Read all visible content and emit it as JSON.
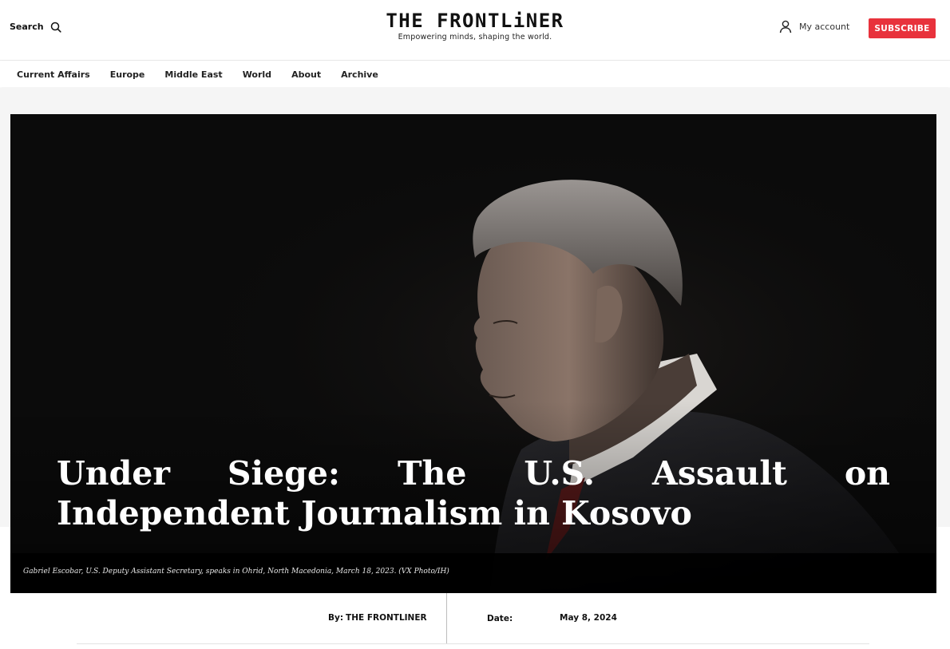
{
  "header": {
    "search_label": "Search",
    "logo_title": "THE FRONTLiNER",
    "logo_tagline": "Empowering minds, shaping the world.",
    "account_label": "My account",
    "subscribe_label": "SUBSCRIBE"
  },
  "nav": {
    "items": [
      "Current Affairs",
      "Europe",
      "Middle East",
      "World",
      "About",
      "Archive"
    ]
  },
  "article": {
    "title": "Under Siege: The U.S. Assault on Independent Journalism in Kosovo",
    "caption": "Gabriel Escobar, U.S. Deputy Assistant Secretary, speaks in Ohrid, North Macedonia, March 18, 2023. (VX Photo/IH)",
    "by_label": "By:",
    "author": "THE FRONTLINER",
    "date_label": "Date:",
    "date": "May 8, 2024"
  },
  "colors": {
    "subscribe": "#e8323c",
    "hero_background": "#0b0b0b"
  },
  "icons": {
    "search": "search-icon",
    "account": "user-icon"
  }
}
